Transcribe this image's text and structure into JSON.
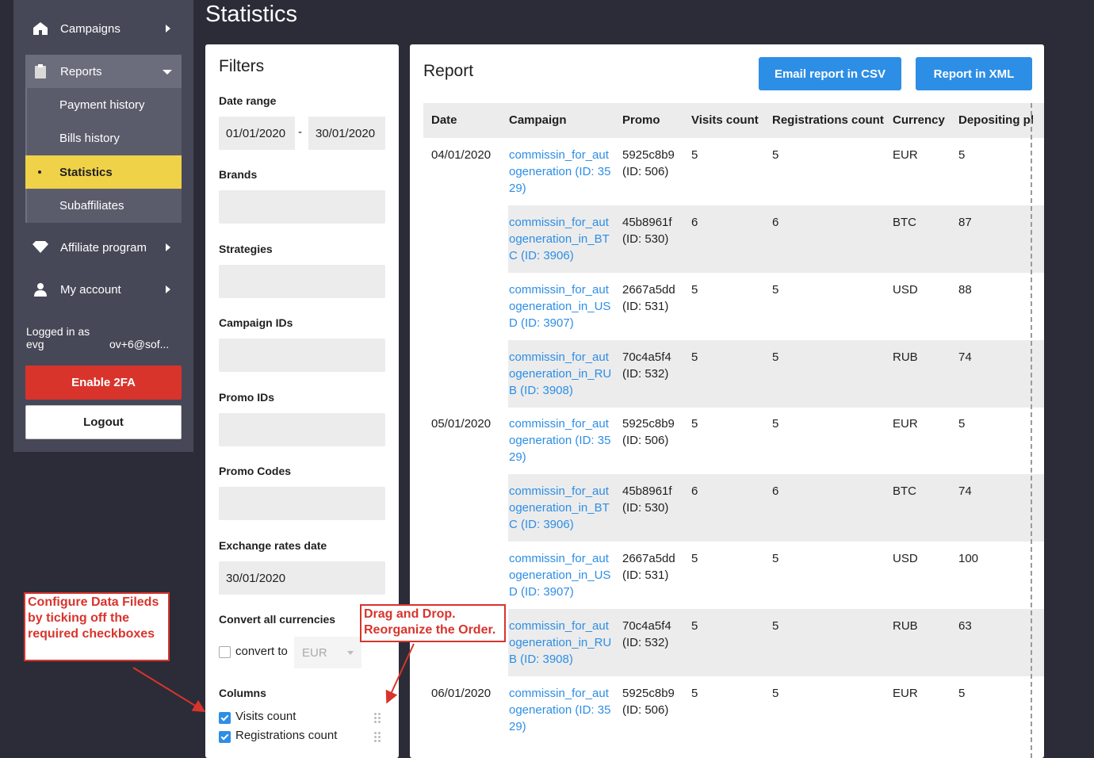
{
  "sidebar": {
    "campaigns": "Campaigns",
    "reports": "Reports",
    "sub": [
      "Payment history",
      "Bills history",
      "Statistics",
      "Subaffiliates"
    ],
    "affiliate": "Affiliate program",
    "account": "My account",
    "logged_label": "Logged in as",
    "logged_user_a": "evg",
    "logged_user_b": "ov+6@sof...",
    "enable_2fa": "Enable 2FA",
    "logout": "Logout"
  },
  "page_title": "Statistics",
  "filters": {
    "title": "Filters",
    "date_range": "Date range",
    "date_from": "01/01/2020",
    "date_sep": "-",
    "date_to": "30/01/2020",
    "brands": "Brands",
    "strategies": "Strategies",
    "campaign_ids": "Campaign IDs",
    "promo_ids": "Promo IDs",
    "promo_codes": "Promo Codes",
    "exchange_label": "Exchange rates date",
    "exchange_value": "30/01/2020",
    "convert_label": "Convert all currencies",
    "convert_to": "convert to",
    "currency": "EUR",
    "columns": "Columns",
    "col_items": [
      "Visits count",
      "Registrations count"
    ]
  },
  "report": {
    "title": "Report",
    "email_csv": "Email report in CSV",
    "xml": "Report in XML",
    "headers": [
      "Date",
      "Campaign",
      "Promo",
      "Visits count",
      "Registrations count",
      "Currency",
      "Depositing pl"
    ],
    "rows": [
      {
        "date": "04/01/2020",
        "campaign": "commissin_for_autogeneration (ID: 3529)",
        "promo": "5925c8b9 (ID: 506)",
        "visits": "5",
        "regs": "5",
        "currency": "EUR",
        "dep": "5"
      },
      {
        "date": "",
        "campaign": "commissin_for_autogeneration_in_BTC (ID: 3906)",
        "promo": "45b8961f (ID: 530)",
        "visits": "6",
        "regs": "6",
        "currency": "BTC",
        "dep": "87"
      },
      {
        "date": "",
        "campaign": "commissin_for_autogeneration_in_USD (ID: 3907)",
        "promo": "2667a5dd (ID: 531)",
        "visits": "5",
        "regs": "5",
        "currency": "USD",
        "dep": "88"
      },
      {
        "date": "",
        "campaign": "commissin_for_autogeneration_in_RUB (ID: 3908)",
        "promo": "70c4a5f4 (ID: 532)",
        "visits": "5",
        "regs": "5",
        "currency": "RUB",
        "dep": "74"
      },
      {
        "date": "05/01/2020",
        "campaign": "commissin_for_autogeneration (ID: 3529)",
        "promo": "5925c8b9 (ID: 506)",
        "visits": "5",
        "regs": "5",
        "currency": "EUR",
        "dep": "5"
      },
      {
        "date": "",
        "campaign": "commissin_for_autogeneration_in_BTC (ID: 3906)",
        "promo": "45b8961f (ID: 530)",
        "visits": "6",
        "regs": "6",
        "currency": "BTC",
        "dep": "74"
      },
      {
        "date": "",
        "campaign": "commissin_for_autogeneration_in_USD (ID: 3907)",
        "promo": "2667a5dd (ID: 531)",
        "visits": "5",
        "regs": "5",
        "currency": "USD",
        "dep": "100"
      },
      {
        "date": "",
        "campaign": "commissin_for_autogeneration_in_RUB (ID: 3908)",
        "promo": "70c4a5f4 (ID: 532)",
        "visits": "5",
        "regs": "5",
        "currency": "RUB",
        "dep": "63"
      },
      {
        "date": "06/01/2020",
        "campaign": "commissin_for_autogeneration (ID: 3529)",
        "promo": "5925c8b9 (ID: 506)",
        "visits": "5",
        "regs": "5",
        "currency": "EUR",
        "dep": "5"
      }
    ]
  },
  "annotations": {
    "configure": "Configure Data Fileds by ticking off the required checkboxes",
    "drag": "Drag and Drop. Reorganize the Order.",
    "color": "#d8342c"
  },
  "icons": [
    "home-icon",
    "clipboard-icon",
    "diamond-icon",
    "user-icon",
    "drag-handle-icon"
  ]
}
